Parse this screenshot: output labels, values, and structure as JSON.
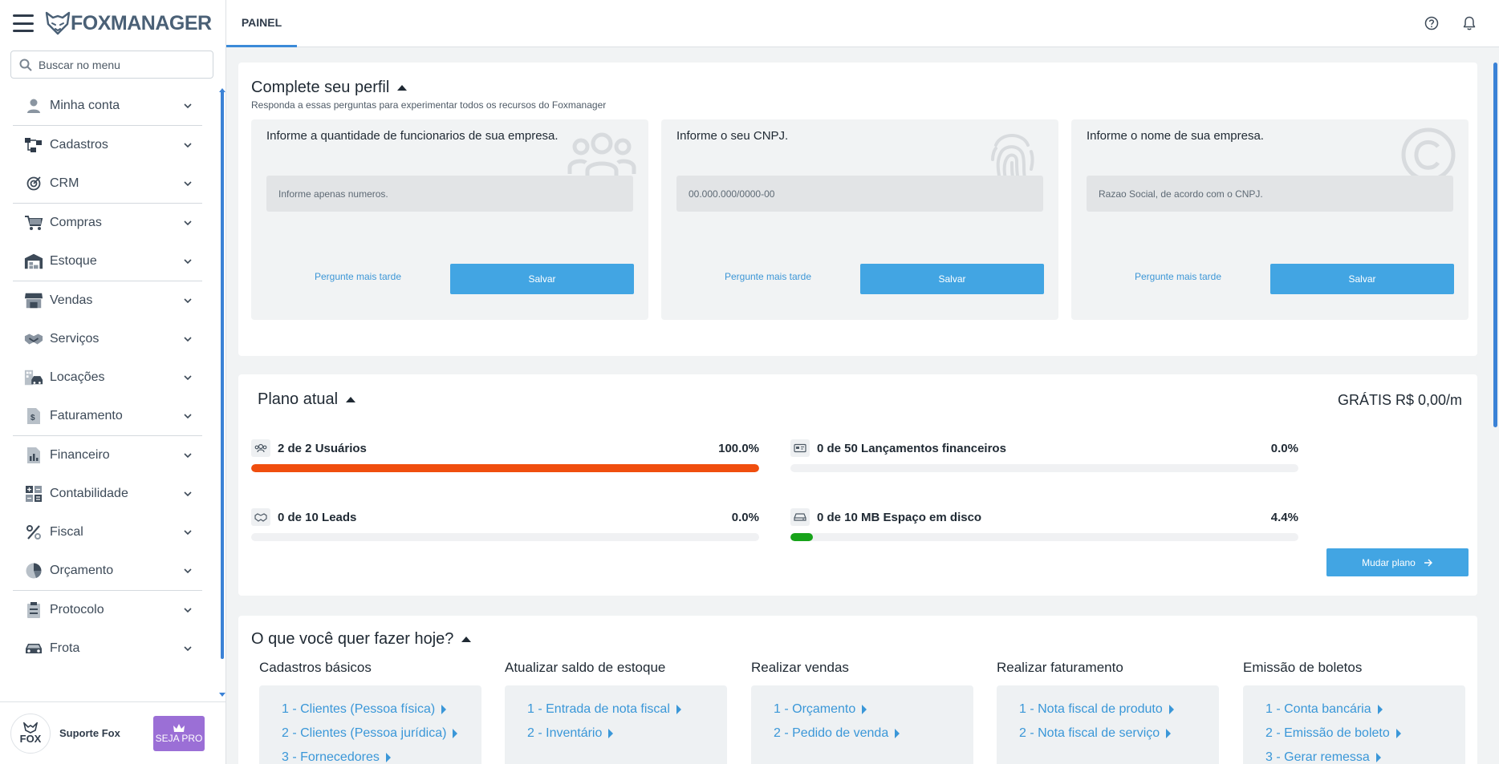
{
  "app": {
    "name": "FOXMANAGER"
  },
  "sidebar": {
    "search_placeholder": "Buscar no menu",
    "items": [
      {
        "label": "Minha conta",
        "icon": "user-icon"
      },
      {
        "label": "Cadastros",
        "icon": "sitemap-icon"
      },
      {
        "label": "CRM",
        "icon": "target-icon"
      },
      {
        "label": "Compras",
        "icon": "cart-icon"
      },
      {
        "label": "Estoque",
        "icon": "warehouse-icon"
      },
      {
        "label": "Vendas",
        "icon": "store-icon"
      },
      {
        "label": "Serviços",
        "icon": "handshake-icon"
      },
      {
        "label": "Locações",
        "icon": "building-car-icon"
      },
      {
        "label": "Faturamento",
        "icon": "invoice-icon"
      },
      {
        "label": "Financeiro",
        "icon": "report-chart-icon"
      },
      {
        "label": "Contabilidade",
        "icon": "calculator-icon"
      },
      {
        "label": "Fiscal",
        "icon": "percent-icon"
      },
      {
        "label": "Orçamento",
        "icon": "pie-chart-icon"
      },
      {
        "label": "Protocolo",
        "icon": "clipboard-icon"
      },
      {
        "label": "Frota",
        "icon": "car-icon"
      }
    ],
    "footer": {
      "support_label": "Suporte Fox",
      "avatar_text": "FOX",
      "pro_label": "SEJA PRO"
    }
  },
  "header": {
    "tab_label": "PAINEL"
  },
  "profile": {
    "title": "Complete seu perfil",
    "subtitle": "Responda a essas perguntas para experimentar todos os recursos do Foxmanager",
    "boxes": [
      {
        "label": "Informe a quantidade de funcionarios de sua empresa.",
        "placeholder": "Informe apenas numeros.",
        "later": "Pergunte mais tarde",
        "save": "Salvar"
      },
      {
        "label": "Informe o seu CNPJ.",
        "placeholder": "00.000.000/0000-00",
        "later": "Pergunte mais tarde",
        "save": "Salvar"
      },
      {
        "label": "Informe o nome de sua empresa.",
        "placeholder": "Razao Social, de acordo com o CNPJ.",
        "later": "Pergunte mais tarde",
        "save": "Salvar"
      }
    ]
  },
  "plan": {
    "title": "Plano atual",
    "price": "GRÁTIS R$ 0,00/m",
    "usage": [
      {
        "label": "2 de 2 Usuários",
        "pct": "100.0%",
        "fill": 1.0,
        "color": "#f04e0e"
      },
      {
        "label": "0 de 50 Lançamentos financeiros",
        "pct": "0.0%",
        "fill": 0.0,
        "color": "#3fa63c"
      },
      {
        "label": "0 de 10 Leads",
        "pct": "0.0%",
        "fill": 0.0,
        "color": "#3fa63c"
      },
      {
        "label": "0 de 10 MB Espaço em disco",
        "pct": "4.4%",
        "fill": 0.044,
        "color": "#17a31a"
      }
    ],
    "change_plan": "Mudar plano"
  },
  "tasks": {
    "title": "O que você quer fazer hoje?",
    "columns": [
      {
        "title": "Cadastros básicos",
        "links": [
          "1 - Clientes (Pessoa física)",
          "2 - Clientes (Pessoa jurídica)",
          "3 - Fornecedores"
        ]
      },
      {
        "title": "Atualizar saldo de estoque",
        "links": [
          "1 - Entrada de nota fiscal",
          "2 - Inventário"
        ]
      },
      {
        "title": "Realizar vendas",
        "links": [
          "1 - Orçamento",
          "2 - Pedido de venda"
        ]
      },
      {
        "title": "Realizar faturamento",
        "links": [
          "1 - Nota fiscal de produto",
          "2 - Nota fiscal de serviço"
        ]
      },
      {
        "title": "Emissão de boletos",
        "links": [
          "1 - Conta bancária",
          "2 - Emissão de boleto",
          "3 - Gerar remessa"
        ]
      }
    ]
  },
  "colors": {
    "accent": "#42a5e3",
    "link": "#3a97d8",
    "pro": "#9b6fd6"
  }
}
